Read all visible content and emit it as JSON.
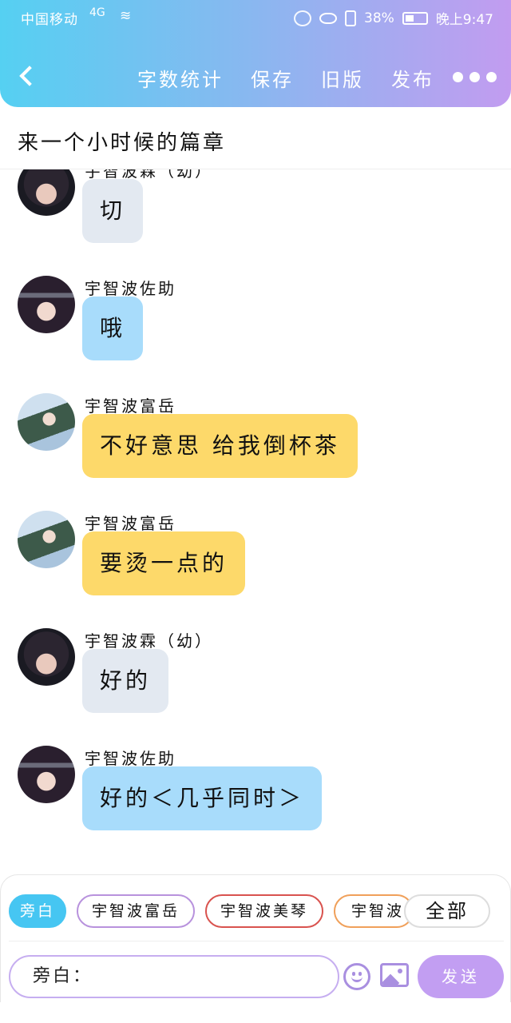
{
  "status_bar": {
    "carrier": "中国移动",
    "signal": "4G",
    "battery": "38%",
    "time": "晚上9:47"
  },
  "header": {
    "nav": [
      "字数统计",
      "保存",
      "旧版",
      "发布"
    ]
  },
  "title": "来一个小时候的篇章",
  "messages": [
    {
      "sender": "宇智波霖（幼）",
      "text": "切",
      "avatar": "haru",
      "color": "#e3e9f1"
    },
    {
      "sender": "宇智波佐助",
      "text": "哦",
      "avatar": "sasuke",
      "color": "#a8dcfb"
    },
    {
      "sender": "宇智波富岳",
      "text": "不好意思 给我倒杯茶",
      "avatar": "fugaku",
      "color": "#fdd96a"
    },
    {
      "sender": "宇智波富岳",
      "text": "要烫一点的",
      "avatar": "fugaku",
      "color": "#fdd96a"
    },
    {
      "sender": "宇智波霖（幼）",
      "text": "好的",
      "avatar": "haru",
      "color": "#e3e9f1"
    },
    {
      "sender": "宇智波佐助",
      "text": "好的＜几乎同时＞",
      "avatar": "sasuke",
      "color": "#a8dcfb"
    }
  ],
  "roles": {
    "narrator": "旁白",
    "fugaku": "宇智波富岳",
    "mikoto": "宇智波美琴",
    "cut": "宇智波",
    "all": "全部"
  },
  "input": {
    "value": "旁白："
  },
  "send_label": "发送",
  "colors": {
    "accent": "#c29ef2",
    "narrator_chip": "#46c6f2"
  }
}
